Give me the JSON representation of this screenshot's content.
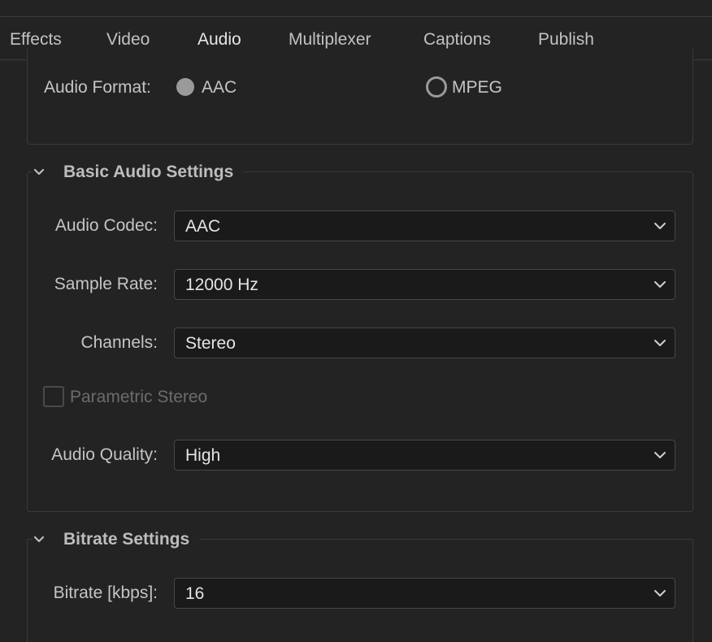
{
  "tabs": [
    {
      "label": "Effects"
    },
    {
      "label": "Video"
    },
    {
      "label": "Audio"
    },
    {
      "label": "Multiplexer"
    },
    {
      "label": "Captions"
    },
    {
      "label": "Publish"
    }
  ],
  "active_tab": "Audio",
  "audio_format": {
    "label": "Audio Format:",
    "options": [
      {
        "label": "AAC",
        "selected": true
      },
      {
        "label": "MPEG",
        "selected": false
      }
    ]
  },
  "basic_audio_settings": {
    "title": "Basic Audio Settings",
    "audio_codec": {
      "label": "Audio Codec:",
      "value": "AAC"
    },
    "sample_rate": {
      "label": "Sample Rate:",
      "value": "12000 Hz"
    },
    "channels": {
      "label": "Channels:",
      "value": "Stereo"
    },
    "parametric_stereo": {
      "label": "Parametric Stereo",
      "checked": false,
      "enabled": false
    },
    "audio_quality": {
      "label": "Audio Quality:",
      "value": "High"
    }
  },
  "bitrate_settings": {
    "title": "Bitrate Settings",
    "bitrate": {
      "label": "Bitrate [kbps]:",
      "value": "16"
    }
  },
  "colors": {
    "background": "#232323",
    "accent": "#3b82d9",
    "field_background": "#1a1a1a"
  },
  "icons": {
    "section_toggle": "chevron-down-icon",
    "dropdown": "chevron-down-icon"
  }
}
